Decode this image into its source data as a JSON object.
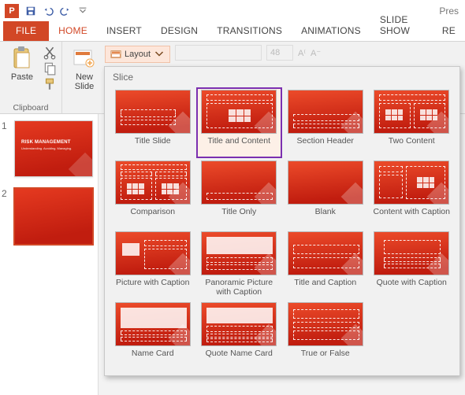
{
  "app": {
    "title_suffix": "Pres",
    "icon_letter": "P"
  },
  "tabs": {
    "file": "FILE",
    "home": "HOME",
    "insert": "INSERT",
    "design": "DESIGN",
    "transitions": "TRANSITIONS",
    "animations": "ANIMATIONS",
    "slideshow": "SLIDE SHOW",
    "review": "RE"
  },
  "ribbon": {
    "clipboard_label": "Clipboard",
    "paste": "Paste",
    "new_slide": "New\nSlide",
    "layout_label": "Layout",
    "font_size": "48"
  },
  "thumbs": [
    {
      "num": "1",
      "title": "RISK MANAGEMENT",
      "sub": "Understanding. Avoiding. Managing."
    },
    {
      "num": "2",
      "title": "",
      "sub": ""
    }
  ],
  "layout_popup": {
    "header": "Slice",
    "items": [
      {
        "label": "Title Slide"
      },
      {
        "label": "Title and Content",
        "selected": true
      },
      {
        "label": "Section Header"
      },
      {
        "label": "Two Content"
      },
      {
        "label": "Comparison"
      },
      {
        "label": "Title Only"
      },
      {
        "label": "Blank"
      },
      {
        "label": "Content with Caption"
      },
      {
        "label": "Picture with Caption"
      },
      {
        "label": "Panoramic Picture with Caption"
      },
      {
        "label": "Title and Caption"
      },
      {
        "label": "Quote with Caption"
      },
      {
        "label": "Name Card"
      },
      {
        "label": "Quote Name Card"
      },
      {
        "label": "True or False"
      }
    ]
  }
}
